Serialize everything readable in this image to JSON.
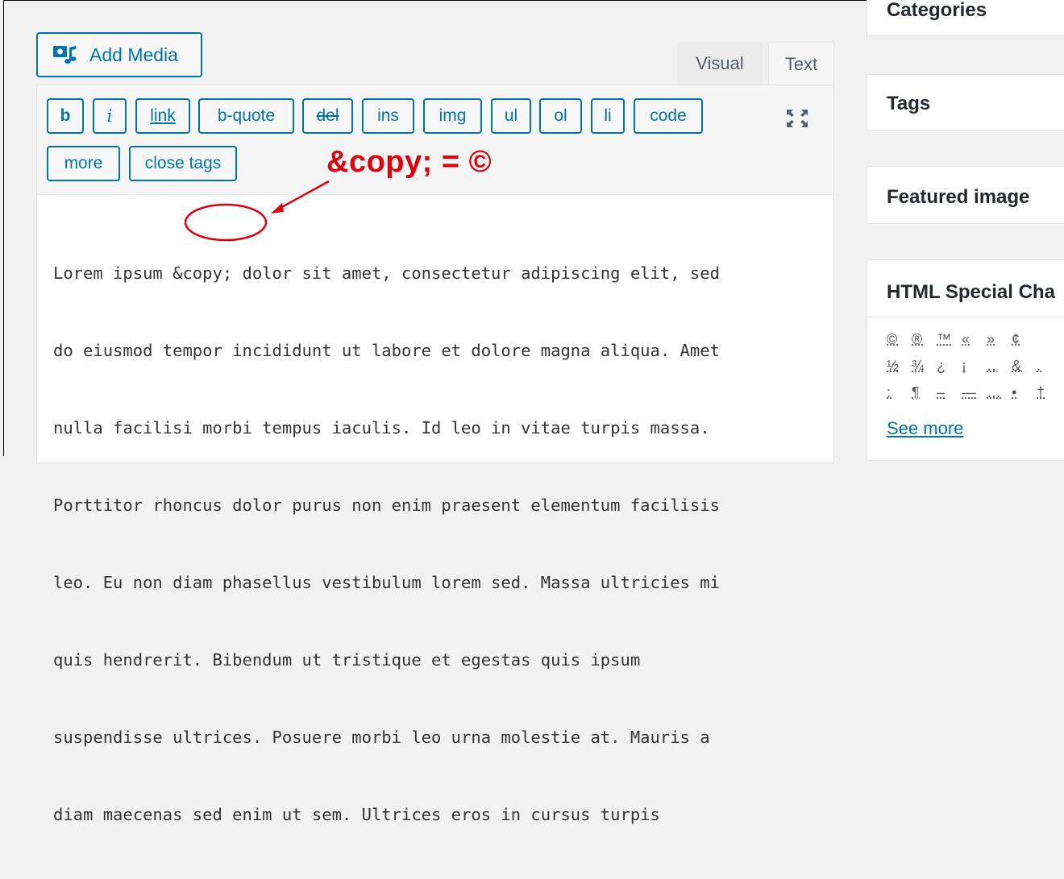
{
  "media_button": {
    "label": "Add Media",
    "icon": "media-icon"
  },
  "tabs": [
    {
      "label": "Visual",
      "active": false
    },
    {
      "label": "Text",
      "active": true
    }
  ],
  "toolbar": {
    "row1": [
      "b",
      "i",
      "link",
      "b-quote",
      "del",
      "ins",
      "img",
      "ul",
      "ol",
      "li",
      "code"
    ],
    "row2": [
      "more",
      "close tags"
    ],
    "fullscreen_icon": "fullscreen-icon"
  },
  "editor": {
    "lines": [
      "Lorem ipsum &copy; dolor sit amet, consectetur adipiscing elit, sed",
      "do eiusmod tempor incididunt ut labore et dolore magna aliqua. Amet",
      "nulla facilisi morbi tempus iaculis. Id leo in vitae turpis massa.",
      "Porttitor rhoncus dolor purus non enim praesent elementum facilisis",
      "leo. Eu non diam phasellus vestibulum lorem sed. Massa ultricies mi",
      "quis hendrerit. Bibendum ut tristique et egestas quis ipsum",
      "suspendisse ultrices. Posuere morbi leo urna molestie at. Mauris a",
      "diam maecenas sed enim ut sem. Ultrices eros in cursus turpis"
    ]
  },
  "annotation": {
    "text": "&copy; = ©",
    "color": "#e0000a"
  },
  "sidebar": {
    "categories_title": "Categories",
    "tags_title": "Tags",
    "featured_title": "Featured image",
    "special_chars": {
      "title": "HTML Special Cha",
      "row1": [
        "©",
        "®",
        "™",
        "«",
        "»",
        "¢"
      ],
      "row2": [
        "½",
        "¾",
        "¿",
        "¡",
        "‥",
        "&",
        "."
      ],
      "row3": [
        ":",
        "¶",
        "–",
        "—",
        "…",
        "•",
        "†"
      ],
      "see_more": "See more"
    }
  },
  "colors": {
    "accent": "#0073aa",
    "annotation": "#e0000a"
  }
}
